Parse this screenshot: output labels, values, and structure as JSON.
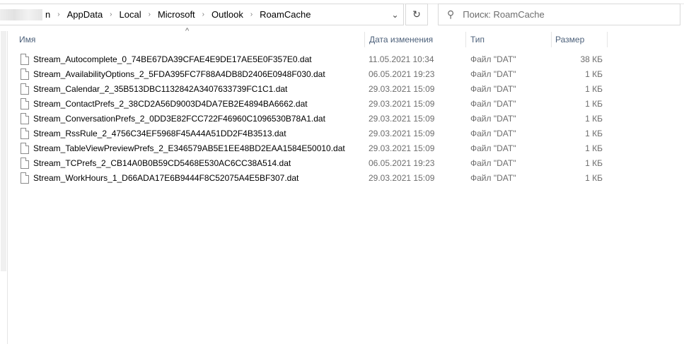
{
  "address": {
    "crumbs": [
      "n",
      "AppData",
      "Local",
      "Microsoft",
      "Outlook",
      "RoamCache"
    ]
  },
  "search": {
    "placeholder": "Поиск: RoamCache"
  },
  "columns": {
    "name": "Имя",
    "date": "Дата изменения",
    "type": "Тип",
    "size": "Размер"
  },
  "files": [
    {
      "name": "Stream_Autocomplete_0_74BE67DA39CFAE4E9DE17AE5E0F357E0.dat",
      "date": "11.05.2021 10:34",
      "type": "Файл \"DAT\"",
      "size": "38 КБ"
    },
    {
      "name": "Stream_AvailabilityOptions_2_5FDA395FC7F88A4DB8D2406E0948F030.dat",
      "date": "06.05.2021 19:23",
      "type": "Файл \"DAT\"",
      "size": "1 КБ"
    },
    {
      "name": "Stream_Calendar_2_35B513DBC1132842A3407633739FC1C1.dat",
      "date": "29.03.2021 15:09",
      "type": "Файл \"DAT\"",
      "size": "1 КБ"
    },
    {
      "name": "Stream_ContactPrefs_2_38CD2A56D9003D4DA7EB2E4894BA6662.dat",
      "date": "29.03.2021 15:09",
      "type": "Файл \"DAT\"",
      "size": "1 КБ"
    },
    {
      "name": "Stream_ConversationPrefs_2_0DD3E82FCC722F46960C1096530B78A1.dat",
      "date": "29.03.2021 15:09",
      "type": "Файл \"DAT\"",
      "size": "1 КБ"
    },
    {
      "name": "Stream_RssRule_2_4756C34EF5968F45A44A51DD2F4B3513.dat",
      "date": "29.03.2021 15:09",
      "type": "Файл \"DAT\"",
      "size": "1 КБ"
    },
    {
      "name": "Stream_TableViewPreviewPrefs_2_E346579AB5E1EE48BD2EAA1584E50010.dat",
      "date": "29.03.2021 15:09",
      "type": "Файл \"DAT\"",
      "size": "1 КБ"
    },
    {
      "name": "Stream_TCPrefs_2_CB14A0B0B59CD5468E530AC6CC38A514.dat",
      "date": "06.05.2021 19:23",
      "type": "Файл \"DAT\"",
      "size": "1 КБ"
    },
    {
      "name": "Stream_WorkHours_1_D66ADA17E6B9444F8C52075A4E5BF307.dat",
      "date": "29.03.2021 15:09",
      "type": "Файл \"DAT\"",
      "size": "1 КБ"
    }
  ]
}
